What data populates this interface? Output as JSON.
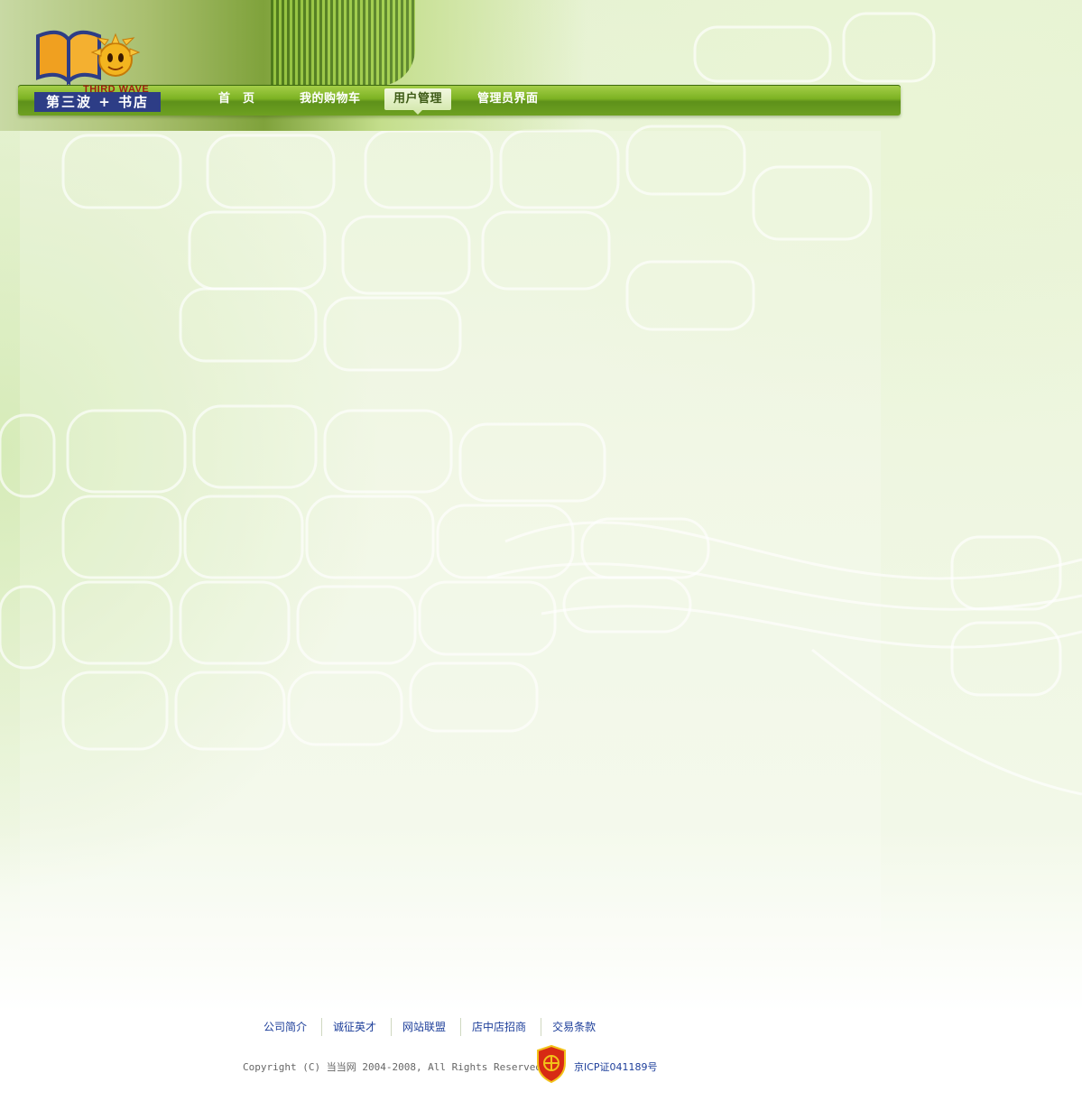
{
  "brand": {
    "name": "第三波 + 书店",
    "subtitle": "THIRD WAVE"
  },
  "nav": {
    "items": [
      {
        "label": "首　页",
        "active": false
      },
      {
        "label": "我的购物车",
        "active": false
      },
      {
        "label": "用户管理",
        "active": true
      },
      {
        "label": "管理员界面",
        "active": false
      }
    ]
  },
  "footer": {
    "links": [
      "公司简介",
      "诚征英才",
      "网站联盟",
      "店中店招商",
      "交易条款"
    ],
    "copyright": "Copyright (C) 当当网 2004-2008, All Rights Reserved",
    "icp": "京ICP证041189号",
    "badge_icon": "police-badge-icon"
  },
  "colors": {
    "nav_green": "#7db223",
    "brand_blue": "#2d3d86",
    "link_blue": "#1d3e9a"
  }
}
